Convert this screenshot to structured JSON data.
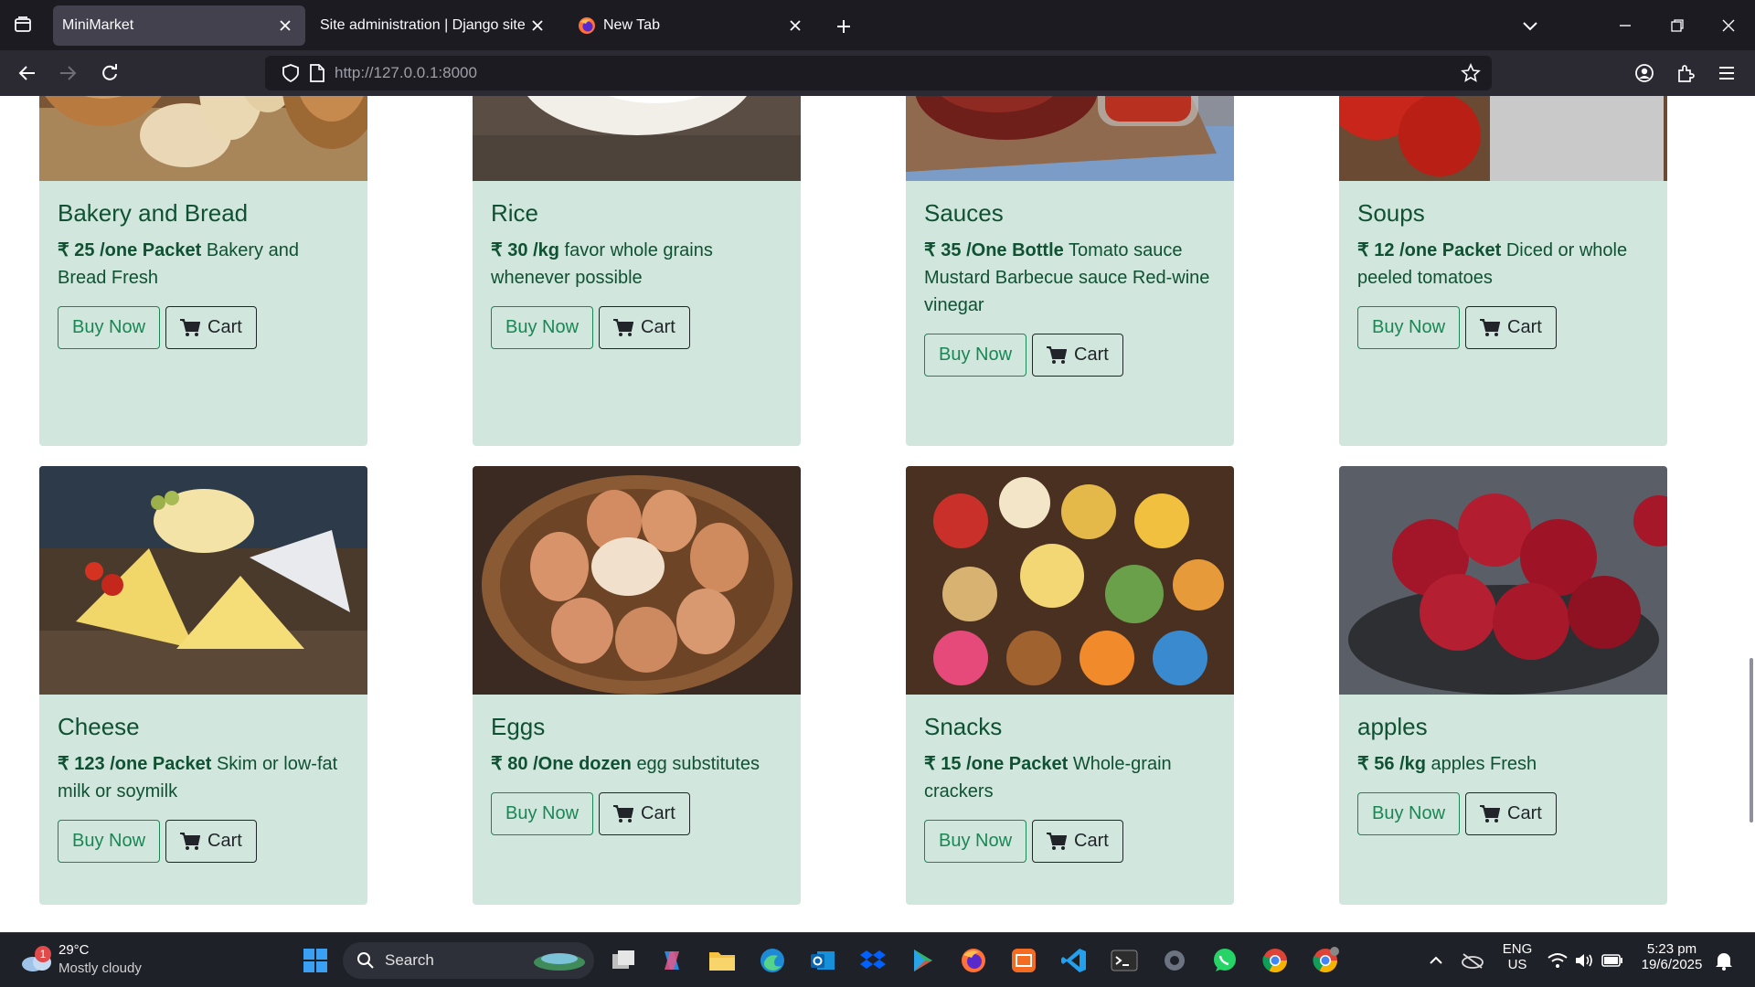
{
  "tabs": [
    {
      "title": "MiniMarket",
      "active": true
    },
    {
      "title": "Site administration | Django site adr",
      "active": false
    },
    {
      "title": "New Tab",
      "active": false
    }
  ],
  "url": {
    "host": "http://127.0.0.1",
    "port": ":8000"
  },
  "products": [
    {
      "name": "Bakery and Bread",
      "price": "₹ 25 /one Packet",
      "desc": "Bakery and Bread Fresh",
      "image": "bread"
    },
    {
      "name": "Rice",
      "price": "₹ 30 /kg",
      "desc": "favor whole grains whenever possible",
      "image": "rice"
    },
    {
      "name": "Sauces",
      "price": "₹ 35 /One Bottle",
      "desc": "Tomato sauce Mustard Barbecue sauce Red-wine vinegar",
      "image": "sauce"
    },
    {
      "name": "Soups",
      "price": "₹ 12 /one Packet",
      "desc": "Diced or whole peeled tomatoes",
      "image": "tomatoes"
    },
    {
      "name": "Cheese",
      "price": "₹ 123 /one Packet",
      "desc": "Skim or low-fat milk or soymilk",
      "image": "cheese"
    },
    {
      "name": "Eggs",
      "price": "₹ 80 /One dozen",
      "desc": "egg substitutes",
      "image": "eggs"
    },
    {
      "name": "Snacks",
      "price": "₹ 15 /one Packet",
      "desc": "Whole-grain crackers",
      "image": "snacks"
    },
    {
      "name": "apples",
      "price": "₹ 56 /kg",
      "desc": "apples Fresh",
      "image": "apples"
    }
  ],
  "buttons": {
    "buy": "Buy Now",
    "cart": "Cart"
  },
  "taskbar": {
    "weather_temp": "29°C",
    "weather_cond": "Mostly cloudy",
    "weather_badge": "1",
    "search_label": "Search",
    "lang_top": "ENG",
    "lang_bottom": "US",
    "time": "5:23 pm",
    "date": "19/6/2025"
  },
  "colors": {
    "card_bg": "#d1e7dd",
    "card_text": "#0f5132",
    "buy_green": "#198754"
  }
}
